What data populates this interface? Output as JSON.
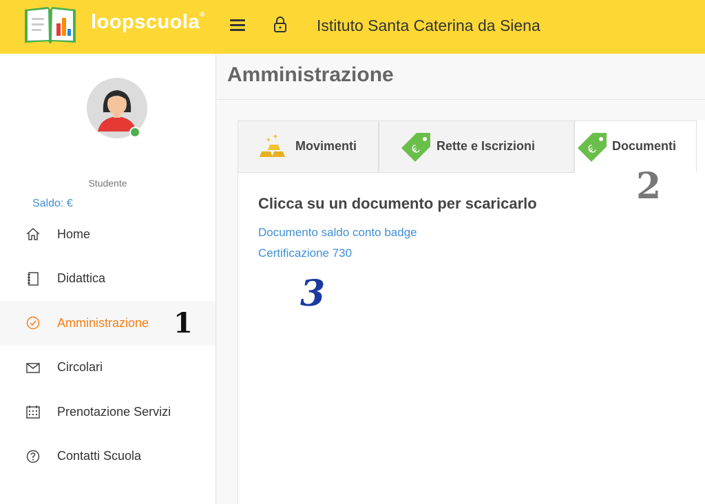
{
  "header": {
    "brand": "loopscuola",
    "brand_mark": "®",
    "school_name": "Istituto Santa Caterina da Siena"
  },
  "sidebar": {
    "role": "Studente",
    "saldo": "Saldo: €",
    "items": [
      {
        "label": "Home",
        "icon": "home-icon"
      },
      {
        "label": "Didattica",
        "icon": "notebook-icon"
      },
      {
        "label": "Amministrazione",
        "icon": "check-circle-icon",
        "active": true
      },
      {
        "label": "Circolari",
        "icon": "envelope-icon"
      },
      {
        "label": "Prenotazione Servizi",
        "icon": "calendar-icon"
      },
      {
        "label": "Contatti Scuola",
        "icon": "question-circle-icon"
      }
    ]
  },
  "main": {
    "title": "Amministrazione",
    "tabs": [
      {
        "label": "Movimenti",
        "icon": "gold-bars-icon"
      },
      {
        "label": "Rette e Iscrizioni",
        "icon": "euro-tag-icon"
      },
      {
        "label": "Documenti",
        "icon": "euro-tag-icon",
        "active": true
      }
    ],
    "heading": "Clicca su un documento per scaricarlo",
    "documents": [
      "Documento saldo conto badge",
      "Certificazione 730"
    ]
  },
  "annotations": {
    "one": "1",
    "two": "2",
    "three": "3"
  },
  "colors": {
    "topbar": "#fdd835",
    "accent_active": "#f57f17",
    "link": "#3f8fd8",
    "tag_green": "#6abf4b",
    "gold": "#f2c232"
  }
}
